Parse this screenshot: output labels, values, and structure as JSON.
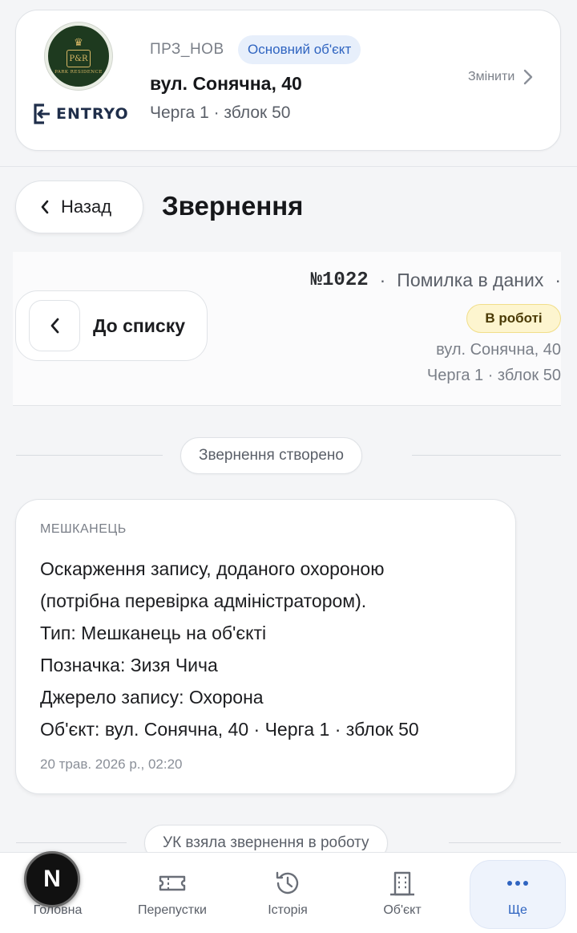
{
  "object": {
    "logo_caption": "PARK RESIDENCE",
    "logo_monogram": "P&R",
    "brand": "ENTRYO",
    "code": "ПРЗ_НОВ",
    "badge": "Основний об'єкт",
    "address": "вул. Сонячна, 40",
    "queue": "Черга 1 · зблок 50",
    "change_label": "Змінити"
  },
  "header": {
    "back_label": "Назад",
    "title": "Звернення"
  },
  "request": {
    "to_list_label": "До списку",
    "number": "№1022",
    "separator": "·",
    "category": "Помилка в даних",
    "trailing_separator": "·",
    "status": "В роботі",
    "status_color": "#fdf5cf",
    "address": "вул. Сонячна, 40",
    "queue": "Черга 1 · зблок 50"
  },
  "timeline": {
    "created_event": "Звернення створено",
    "message": {
      "author": "МЕШКАНЕЦЬ",
      "lines": [
        "Оскарження запису, доданого охороною",
        "(потрібна перевірка адміністратором).",
        "Тип: Мешканець на об'єкті",
        "Позначка: Зизя Чича",
        "Джерело запису: Охорона",
        "Об'єкт: вул. Сонячна, 40 · Черга 1 · зблок 50"
      ],
      "time": "20 трав. 2026 р., 02:20"
    },
    "taken_event": "УК взяла звернення в роботу"
  },
  "nav": {
    "items": [
      {
        "label": "Головна",
        "icon": "home-icon"
      },
      {
        "label": "Перепустки",
        "icon": "ticket-icon"
      },
      {
        "label": "Історія",
        "icon": "history-icon"
      },
      {
        "label": "Об'єкт",
        "icon": "building-icon"
      },
      {
        "label": "Ще",
        "icon": "more-icon"
      }
    ],
    "active_color": "#2f64c0"
  },
  "dev_badge": "N"
}
